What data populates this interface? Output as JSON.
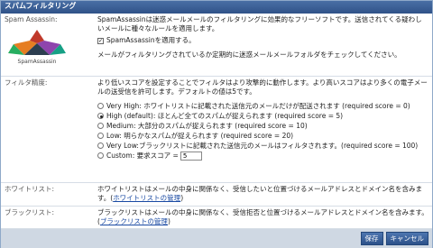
{
  "title": "スパムフィルタリング",
  "spamassassin": {
    "label": "Spam Assassin:",
    "logo_text": "SpamAssassin",
    "description": "SpamAssassinは迷惑メールメールのフィルタリングに効果的なフリーソフトです。送信されてくる疑わしいメールに種々なルールを適用します。",
    "apply_label": "SpamAssassinを適用する。",
    "apply_checked": true,
    "note": "メールがフィルタリングされているか定期的に迷惑メールメールフォルダをチェックしてください。"
  },
  "filter": {
    "label": "フィルタ精度:",
    "description": "より低いスコアを設定することでフィルタはより攻撃的に動作します。より高いスコアはより多くの電子メールの送受信を許可します。デフォルトの値は5です。",
    "options": [
      {
        "label": "Very High: ホワイトリストに記載された送信元のメールだけが配送されます (required score = 0)",
        "selected": false
      },
      {
        "label": "High (default): ほとんど全てのスパムが捉えられます (required score = 5)",
        "selected": true
      },
      {
        "label": "Medium: 大部分のスパムが捉えられます (required score = 10)",
        "selected": false
      },
      {
        "label": "Low: 明らかなスパムが捉えられます (required score = 20)",
        "selected": false
      },
      {
        "label": "Very Low:ブラックリストに記載された送信元のメールはフィルタされます。(required score = 100)",
        "selected": false
      },
      {
        "label": "Custom: 要求スコア =",
        "selected": false
      }
    ],
    "custom_score": "5"
  },
  "whitelist": {
    "label": "ホワイトリスト:",
    "text": "ホワイトリストはメールの中身に関係なく、受信したいと位置づけるメールアドレスとドメイン名を含みます。(",
    "link": "ホワイトリストの管理",
    "close": ")"
  },
  "blacklist": {
    "label": "ブラックリスト:",
    "text": "ブラックリストはメールの中身に関係なく、受信拒否と位置づけるメールアドレスとドメイン名を含みます。(",
    "link": "ブラックリストの管理",
    "close": ")"
  },
  "buttons": {
    "save": "保存",
    "cancel": "キャンセル"
  }
}
